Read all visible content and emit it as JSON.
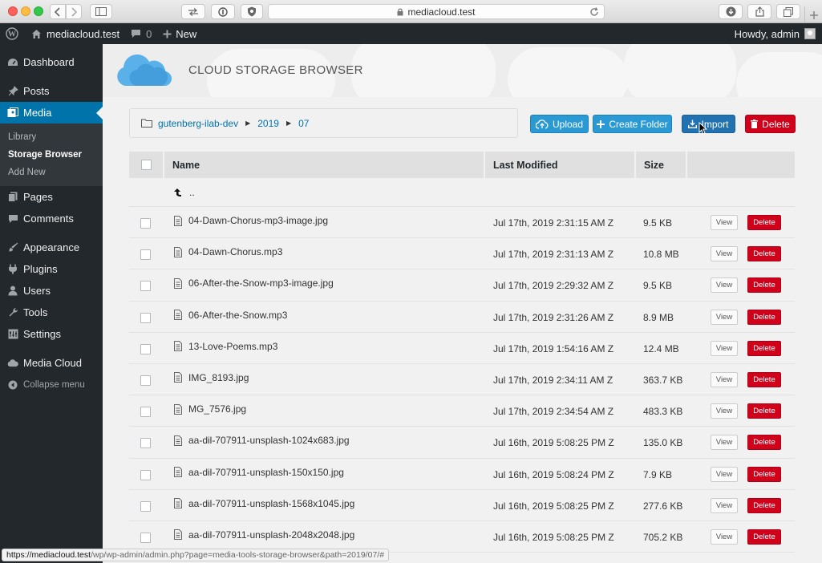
{
  "browser": {
    "url": "mediacloud.test"
  },
  "admin_bar": {
    "site_name": "mediacloud.test",
    "comments_count": "0",
    "new_label": "New",
    "greeting": "Howdy, admin"
  },
  "sidebar": {
    "dashboard": "Dashboard",
    "posts": "Posts",
    "media": "Media",
    "submenu": [
      "Library",
      "Storage Browser",
      "Add New"
    ],
    "pages": "Pages",
    "comments": "Comments",
    "appearance": "Appearance",
    "plugins": "Plugins",
    "users": "Users",
    "tools": "Tools",
    "settings": "Settings",
    "media_cloud": "Media Cloud",
    "collapse": "Collapse menu"
  },
  "header": {
    "title": "CLOUD STORAGE BROWSER"
  },
  "breadcrumb": [
    "gutenberg-ilab-dev",
    "2019",
    "07"
  ],
  "toolbar": {
    "upload": "Upload",
    "create_folder": "Create Folder",
    "import": "Import",
    "delete": "Delete"
  },
  "table": {
    "columns": [
      "Name",
      "Last Modified",
      "Size"
    ],
    "parent_label": "..",
    "view_label": "View",
    "delete_label": "Delete",
    "rows": [
      {
        "name": "04-Dawn-Chorus-mp3-image.jpg",
        "modified": "Jul 17th, 2019 2:31:15 AM Z",
        "size": "9.5 KB"
      },
      {
        "name": "04-Dawn-Chorus.mp3",
        "modified": "Jul 17th, 2019 2:31:13 AM Z",
        "size": "10.8 MB"
      },
      {
        "name": "06-After-the-Snow-mp3-image.jpg",
        "modified": "Jul 17th, 2019 2:29:32 AM Z",
        "size": "9.5 KB"
      },
      {
        "name": "06-After-the-Snow.mp3",
        "modified": "Jul 17th, 2019 2:31:26 AM Z",
        "size": "8.9 MB"
      },
      {
        "name": "13-Love-Poems.mp3",
        "modified": "Jul 17th, 2019 1:54:16 AM Z",
        "size": "12.4 MB"
      },
      {
        "name": "IMG_8193.jpg",
        "modified": "Jul 17th, 2019 2:34:11 AM Z",
        "size": "363.7 KB"
      },
      {
        "name": "MG_7576.jpg",
        "modified": "Jul 17th, 2019 2:34:54 AM Z",
        "size": "483.3 KB"
      },
      {
        "name": "aa-dil-707911-unsplash-1024x683.jpg",
        "modified": "Jul 16th, 2019 5:08:25 PM Z",
        "size": "135.0 KB"
      },
      {
        "name": "aa-dil-707911-unsplash-150x150.jpg",
        "modified": "Jul 16th, 2019 5:08:24 PM Z",
        "size": "7.9 KB"
      },
      {
        "name": "aa-dil-707911-unsplash-1568x1045.jpg",
        "modified": "Jul 16th, 2019 5:08:25 PM Z",
        "size": "277.6 KB"
      },
      {
        "name": "aa-dil-707911-unsplash-2048x2048.jpg",
        "modified": "Jul 16th, 2019 5:08:25 PM Z",
        "size": "705.2 KB"
      }
    ]
  },
  "status_bar": {
    "host": "https://mediacloud.test",
    "path": "/wp/wp-admin/admin.php?page=media-tools-storage-browser&path=2019/07/#"
  },
  "colors": {
    "wp_dark": "#23282d",
    "wp_blue": "#0073aa",
    "button_blue": "#2b9ad4",
    "delete_red": "#d0021b"
  }
}
